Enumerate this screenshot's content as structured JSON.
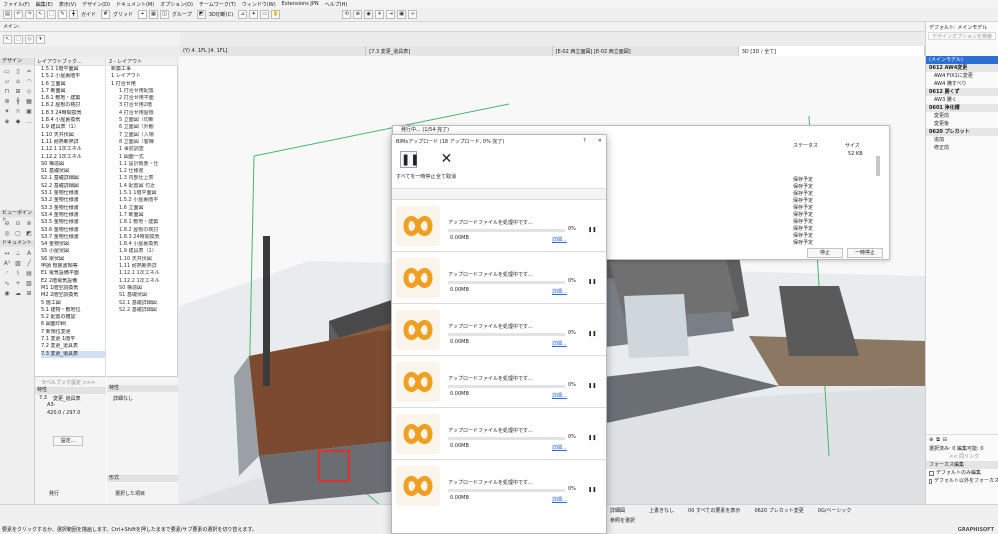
{
  "menu": [
    "ファイル(F)",
    "編集(E)",
    "表示(V)",
    "デザイン(D)",
    "ドキュメント(M)",
    "オプション(O)",
    "チームワーク(T)",
    "ウィンドウ(W)",
    "Extensions JPN",
    "ヘルプ(H)"
  ],
  "toolbar": {
    "labels": [
      "ガイド",
      "グリッド",
      "グループ",
      "3D切断(C)"
    ]
  },
  "toolbar2": {
    "label": "メイン:"
  },
  "view_tabs": [
    "(Y) 4. 1FL [4. 1FL]",
    "[7.3 変更_道具表]",
    "[E-02 西立面図] [E-02 西立面図]",
    "3D [3D / 全て]"
  ],
  "tool_sections": [
    "デザイン",
    "ビューポイント",
    "ドキュメント"
  ],
  "nav": {
    "search_placeholder": "レイアウトブック...",
    "layout_dropdown": "2 - レイアウト",
    "left_items": [
      "1.5.1 1階平面図",
      "1.5.2 小屋裏階平",
      "1.6 立面図",
      "1.7 断面図",
      "1.8.1 敷地・建築",
      "1.8.2 屋根の検討",
      "1.8.3 24時間換気",
      "1.8.4 小屋裏換気",
      "1.9 建具表（1）",
      "1.10 天井伏図",
      "1.11 耐熱断熱詳",
      "1.12.1 1次エネル",
      "1.12.2 1次エネル",
      "S0 構造図",
      "S1 基礎伏図",
      "S2.1 基礎詳細図",
      "S2.2 基礎詳細図",
      "S3.1 金物仕様書",
      "S3.2 金物仕様書",
      "S3.3 金物仕様書",
      "S3.4 金物仕様書",
      "S3.5 金物仕様書",
      "S3.6 金物仕様書",
      "S3.7 金物仕様書",
      "S4 金物伏図",
      "S5 小屋伏図",
      "S6 梁伏図",
      "申請 根拠書類等",
      "E1 電気設備平面",
      "E2 2階電気設備",
      "M1 1階空調換気",
      "M2 2階空調換気",
      "5 施工図",
      "5.1 建物・敷地位",
      "5.2 配置の確認",
      "6 図面印刷",
      "7 新規位変更",
      "7.1 変更 1階平",
      "7.2 変更_道具表",
      "7.3 変更_道具表"
    ],
    "right_items": [
      "新築工事",
      "1 レイアウト",
      "1 打合せ用",
      "1 打合せ用配置",
      "2 打合せ用平面",
      "3 打合せ用2階",
      "4 打合せ用屋根",
      "5 立面図（切断",
      "6 立面図（外観",
      "7 立面図（入場",
      "8 立面図（客棟",
      "1 事前調査",
      "1 図面一式",
      "1.1 設計概要・仕",
      "1.2 仕様書",
      "1.3 内部仕上表",
      "1.4 配置図 付近",
      "1.5.1 1階平面図",
      "1.5.2 小屋裏階平",
      "1.6 立面図",
      "1.7 断面図",
      "1.8.1 敷地・建築",
      "1.8.2 屋根の検討",
      "1.8.3 24時間換気",
      "1.8.4 小屋裏換気",
      "1.9 建具表（1）",
      "1.10 天井伏図",
      "1.11 耐熱断熱詳",
      "1.12.1 1次エネル",
      "1.12.2 1次エネル",
      "S0 構造図",
      "S1 基礎伏図",
      "S2.1 基礎詳細図",
      "S2.2 基礎詳細図"
    ],
    "view_search": "ラベルブック設定 >>>",
    "props_head": "特性",
    "props": [
      "7.3",
      "変更_道具表",
      "A3-",
      "420.0 / 297.0"
    ],
    "settings_btn": "設定...",
    "detail_head": "特性",
    "detail_item": "詳細なし",
    "form_head": "形式",
    "bottom_left": "発行",
    "bottom_right": "選択した項目"
  },
  "right_panel": {
    "header": "デフォルト: メインモデル",
    "search_placeholder": "デザインオプションを検索",
    "items": [
      "(メインモデル)",
      "0612 AW4変更",
      "AW4 FIX1に変更",
      "AW4 横すべり",
      "0612 勝くず",
      "AW3 勝く",
      "0601 浄化槽",
      "変更前",
      "変更後",
      "0620 プレカット",
      "追加",
      "修正前"
    ],
    "selected_label": "選択済み: 0 編集可能: 0",
    "link_label": "<< 同リンク",
    "focus_head": "フォーカス編集",
    "checkbox1": "デフォルトのみ編集",
    "checkbox2": "デフォルト以外をフォーカス"
  },
  "status": {
    "message": "要素をクリックするか、選択範囲を描画します。Ctrl+Shiftを押したままで要素/サブ要素の選択を切り替えます。",
    "detail_level": "詳細図",
    "layer": "上書きなし",
    "view_scheme": "00 すべての要素を表示",
    "option": "0620 プレカット変更",
    "renovation": "0G/ベーシック",
    "ref": "参照を選択",
    "brand": "GRAPHISOFT"
  },
  "bg_dialog": {
    "title": "発行中... (1/54 完了)",
    "col_status": "ステータス",
    "col_size": "サイズ",
    "size_value": "52 KB",
    "status_values": [
      "保存予定",
      "保存予定",
      "保存予定",
      "保存予定",
      "保存予定",
      "保存予定",
      "保存予定",
      "保存予定",
      "保存予定",
      "保存予定"
    ],
    "btn_stop": "停止",
    "btn_pause": "一時停止"
  },
  "upload_dialog": {
    "title": "BIMxアップロード (18 アップロード, 0% 完了)",
    "help": "?",
    "close": "✕",
    "pause_label": "すべてを一時停止",
    "cancel_label": "全て取消",
    "items": [
      {
        "status": "アップロードファイルを処理中です...",
        "percent": "0%",
        "size": "0.00MB",
        "link": "詳細..."
      },
      {
        "status": "アップロードファイルを処理中です...",
        "percent": "0%",
        "size": "0.00MB",
        "link": "詳細..."
      },
      {
        "status": "アップロードファイルを処理中です...",
        "percent": "0%",
        "size": "0.00MB",
        "link": "詳細..."
      },
      {
        "status": "アップロードファイルを処理中です...",
        "percent": "0%",
        "size": "0.00MB",
        "link": "詳細..."
      },
      {
        "status": "アップロードファイルを処理中です...",
        "percent": "0%",
        "size": "0.00MB",
        "link": "詳細..."
      },
      {
        "status": "アップロードファイルを処理中です...",
        "percent": "0%",
        "size": "0.00MB",
        "link": "詳細..."
      }
    ]
  },
  "colors": {
    "accent": "#2b6fd6",
    "logo": "#f0a020",
    "selection": "#cfe0f7",
    "grass": "#6f8f4e"
  }
}
